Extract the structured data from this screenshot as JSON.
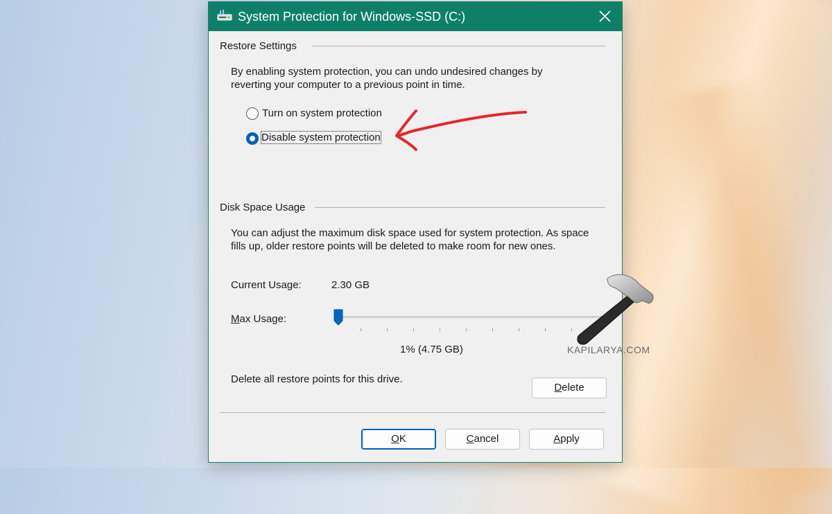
{
  "dialog": {
    "title": "System Protection for Windows-SSD (C:)",
    "restore_settings": {
      "heading": "Restore Settings",
      "description_line1": "By enabling system protection, you can undo undesired changes by",
      "description_line2": "reverting your computer to a previous point in time.",
      "options": [
        {
          "label": "Turn on system protection",
          "selected": false
        },
        {
          "label": "Disable system protection",
          "selected": true
        }
      ]
    },
    "disk_space": {
      "heading": "Disk Space Usage",
      "description_line1": "You can adjust the maximum disk space used for system protection. As space",
      "description_line2": "fills up, older restore points will be deleted to make room for new ones.",
      "current_usage_label": "Current Usage:",
      "current_usage_value": "2.30 GB",
      "max_usage_label_first": "M",
      "max_usage_label_rest": "ax Usage:",
      "max_usage_value": "1% (4.75 GB)",
      "max_usage_percent": 1,
      "delete_text": "Delete all restore points for this drive.",
      "delete_button_first": "D",
      "delete_button_rest": "elete"
    },
    "buttons": {
      "ok_first": "O",
      "ok_rest": "K",
      "cancel_first": "C",
      "cancel_rest": "ancel",
      "apply_first": "A",
      "apply_rest": "pply"
    }
  },
  "annotation": {
    "arrow_color": "#e8262a"
  },
  "watermark": {
    "text": "KAPILARYA.COM"
  },
  "colors": {
    "titlebar": "#0e8068",
    "accent": "#005fb8"
  }
}
